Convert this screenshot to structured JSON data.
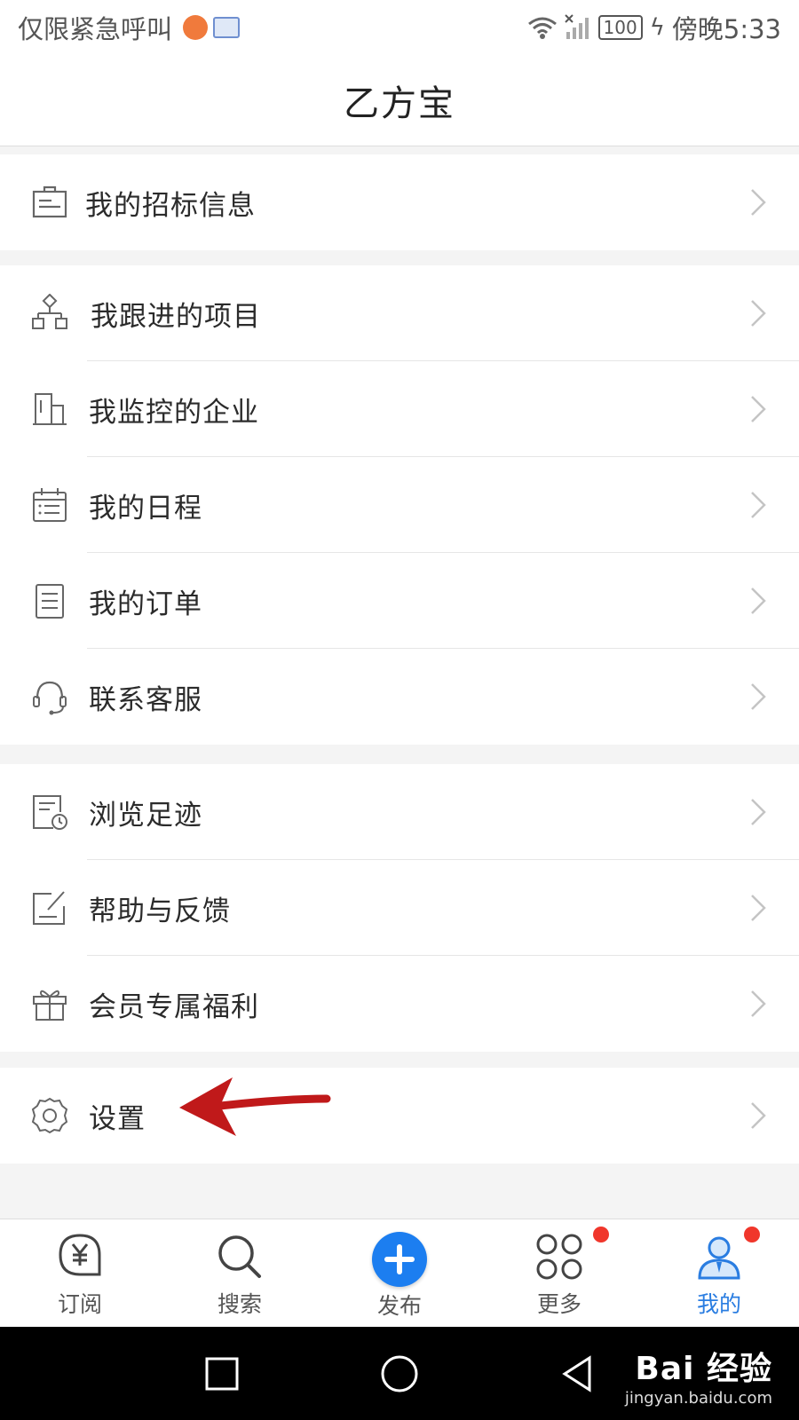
{
  "status_bar": {
    "left_text": "仅限紧急呼叫",
    "battery": "100",
    "time": "傍晚5:33"
  },
  "header": {
    "title": "乙方宝"
  },
  "menu_groups": [
    {
      "items": [
        {
          "label": "我的招标信息",
          "icon": "bidding-info-icon"
        }
      ]
    },
    {
      "items": [
        {
          "label": "我跟进的项目",
          "icon": "project-tree-icon"
        },
        {
          "label": "我监控的企业",
          "icon": "building-icon"
        },
        {
          "label": "我的日程",
          "icon": "calendar-icon"
        },
        {
          "label": "我的订单",
          "icon": "order-document-icon"
        },
        {
          "label": "联系客服",
          "icon": "headset-icon"
        }
      ]
    },
    {
      "items": [
        {
          "label": "浏览足迹",
          "icon": "history-icon"
        },
        {
          "label": "帮助与反馈",
          "icon": "feedback-icon"
        },
        {
          "label": "会员专属福利",
          "icon": "gift-icon"
        }
      ]
    },
    {
      "items": [
        {
          "label": "设置",
          "icon": "gear-icon"
        }
      ]
    }
  ],
  "bottom_nav": [
    {
      "label": "订阅",
      "icon": "subscribe-icon"
    },
    {
      "label": "搜索",
      "icon": "search-icon"
    },
    {
      "label": "发布",
      "icon": "plus-icon"
    },
    {
      "label": "更多",
      "icon": "grid-icon",
      "badge": true
    },
    {
      "label": "我的",
      "icon": "profile-icon",
      "badge": true,
      "active": true
    }
  ],
  "watermark": {
    "title": "Bai 经验",
    "url": "jingyan.baidu.com"
  },
  "colors": {
    "accent": "#1c7ef0",
    "badge": "#f0362b",
    "annotation": "#c0191a"
  }
}
